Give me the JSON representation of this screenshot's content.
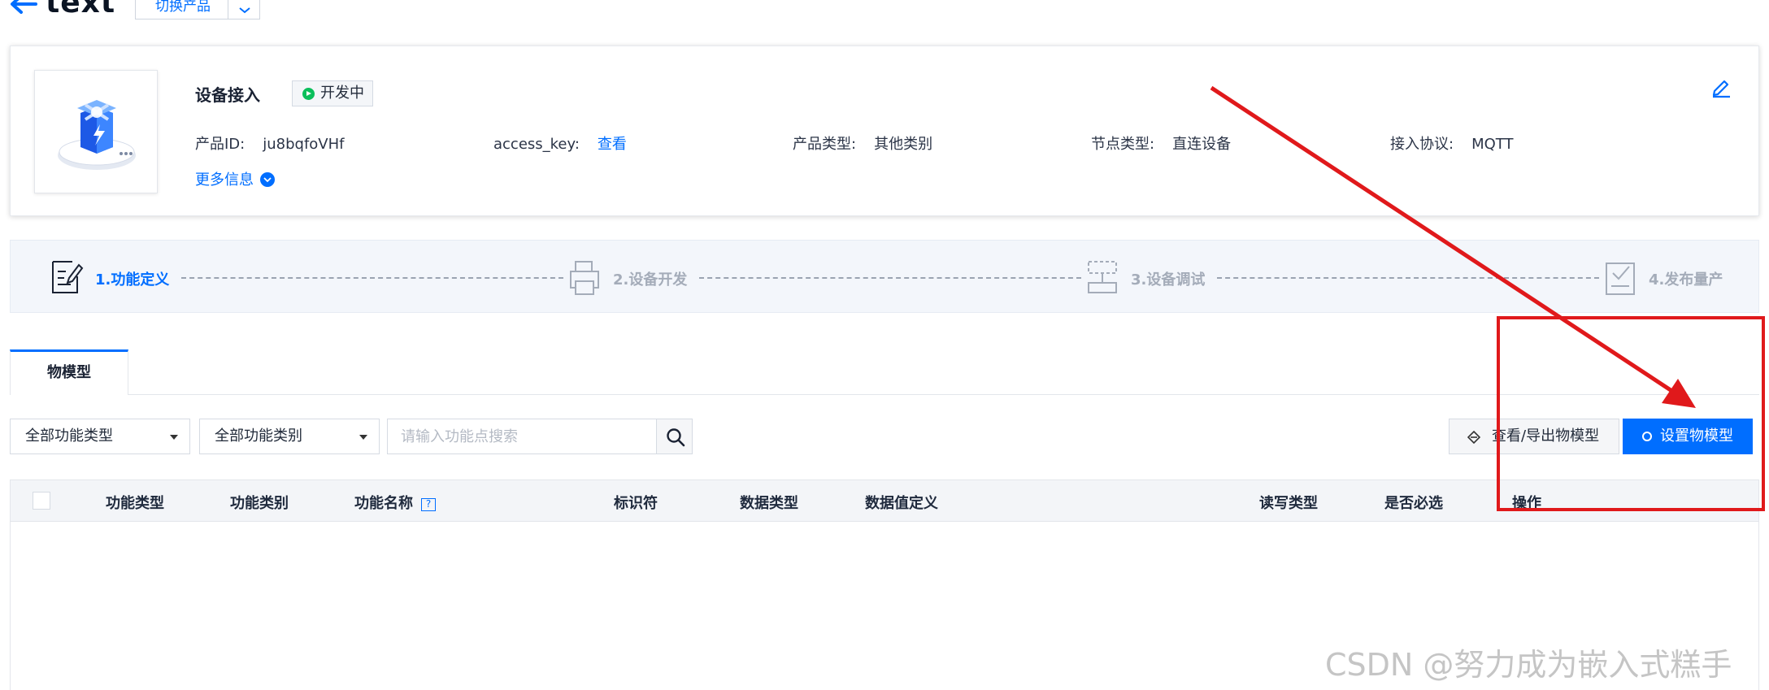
{
  "header": {
    "title": "text",
    "switch_label": "切换产品"
  },
  "product": {
    "name": "设备接入",
    "status": "开发中",
    "fields": {
      "id_label": "产品ID:",
      "id_value": "ju8bqfoVHf",
      "key_label": "access_key:",
      "key_link": "查看",
      "type_label": "产品类型:",
      "type_value": "其他类别",
      "node_label": "节点类型:",
      "node_value": "直连设备",
      "protocol_label": "接入协议:",
      "protocol_value": "MQTT"
    },
    "more_info": "更多信息"
  },
  "steps": [
    {
      "label": "1.功能定义",
      "state": "active"
    },
    {
      "label": "2.设备开发",
      "state": "inactive"
    },
    {
      "label": "3.设备调试",
      "state": "inactive"
    },
    {
      "label": "4.发布量产",
      "state": "inactive"
    }
  ],
  "tabs": [
    {
      "label": "物模型"
    }
  ],
  "filters": {
    "type_select": "全部功能类型",
    "category_select": "全部功能类别",
    "search_placeholder": "请输入功能点搜索"
  },
  "actions": {
    "export_label": "查看/导出物模型",
    "setup_label": "设置物模型"
  },
  "table": {
    "columns": [
      "功能类型",
      "功能类别",
      "功能名称",
      "标识符",
      "数据类型",
      "数据值定义",
      "读写类型",
      "是否必选",
      "操作"
    ],
    "help_glyph": "?"
  },
  "watermark": "CSDN @努力成为嵌入式糕手",
  "colors": {
    "primary": "#006eff",
    "status_green": "#0abf5b",
    "annotation_red": "#e0191b"
  }
}
